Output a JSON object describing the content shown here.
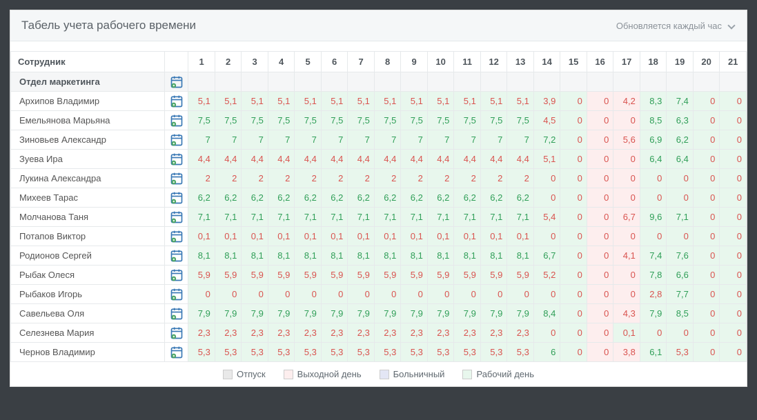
{
  "header": {
    "title": "Табель учета рабочего времени",
    "refresh": "Обновляется каждый час"
  },
  "columns": {
    "employee": "Сотрудник",
    "days": [
      "1",
      "2",
      "3",
      "4",
      "5",
      "6",
      "7",
      "8",
      "9",
      "10",
      "11",
      "12",
      "13",
      "14",
      "15",
      "16",
      "17",
      "18",
      "19",
      "20",
      "21"
    ]
  },
  "group": {
    "name": "Отдел маркетинга"
  },
  "weekend_days": [
    16,
    17
  ],
  "employees": [
    {
      "name": "Архипов Владимир",
      "vals": [
        "5,1",
        "5,1",
        "5,1",
        "5,1",
        "5,1",
        "5,1",
        "5,1",
        "5,1",
        "5,1",
        "5,1",
        "5,1",
        "5,1",
        "5,1",
        "3,9",
        "0",
        "0",
        "4,2",
        "8,3",
        "7,4",
        "0",
        "0"
      ],
      "is_red": true
    },
    {
      "name": "Емельянова Марьяна",
      "vals": [
        "7,5",
        "7,5",
        "7,5",
        "7,5",
        "7,5",
        "7,5",
        "7,5",
        "7,5",
        "7,5",
        "7,5",
        "7,5",
        "7,5",
        "7,5",
        "4,5",
        "0",
        "0",
        "0",
        "8,5",
        "6,3",
        "0",
        "0"
      ],
      "is_red": false
    },
    {
      "name": "Зиновьев Александр",
      "vals": [
        "7",
        "7",
        "7",
        "7",
        "7",
        "7",
        "7",
        "7",
        "7",
        "7",
        "7",
        "7",
        "7",
        "7,2",
        "0",
        "0",
        "5,6",
        "6,9",
        "6,2",
        "0",
        "0"
      ],
      "is_red": false
    },
    {
      "name": "Зуева Ира",
      "vals": [
        "4,4",
        "4,4",
        "4,4",
        "4,4",
        "4,4",
        "4,4",
        "4,4",
        "4,4",
        "4,4",
        "4,4",
        "4,4",
        "4,4",
        "4,4",
        "5,1",
        "0",
        "0",
        "0",
        "6,4",
        "6,4",
        "0",
        "0"
      ],
      "is_red": true
    },
    {
      "name": "Лукина Александра",
      "vals": [
        "2",
        "2",
        "2",
        "2",
        "2",
        "2",
        "2",
        "2",
        "2",
        "2",
        "2",
        "2",
        "2",
        "0",
        "0",
        "0",
        "0",
        "0",
        "0",
        "0",
        "0"
      ],
      "is_red": true
    },
    {
      "name": "Михеев Тарас",
      "vals": [
        "6,2",
        "6,2",
        "6,2",
        "6,2",
        "6,2",
        "6,2",
        "6,2",
        "6,2",
        "6,2",
        "6,2",
        "6,2",
        "6,2",
        "6,2",
        "0",
        "0",
        "0",
        "0",
        "0",
        "0",
        "0",
        "0"
      ],
      "is_red": false
    },
    {
      "name": "Молчанова Таня",
      "vals": [
        "7,1",
        "7,1",
        "7,1",
        "7,1",
        "7,1",
        "7,1",
        "7,1",
        "7,1",
        "7,1",
        "7,1",
        "7,1",
        "7,1",
        "7,1",
        "5,4",
        "0",
        "0",
        "6,7",
        "9,6",
        "7,1",
        "0",
        "0"
      ],
      "is_red": false
    },
    {
      "name": "Потапов Виктор",
      "vals": [
        "0,1",
        "0,1",
        "0,1",
        "0,1",
        "0,1",
        "0,1",
        "0,1",
        "0,1",
        "0,1",
        "0,1",
        "0,1",
        "0,1",
        "0,1",
        "0",
        "0",
        "0",
        "0",
        "0",
        "0",
        "0",
        "0"
      ],
      "is_red": true
    },
    {
      "name": "Родионов Сергей",
      "vals": [
        "8,1",
        "8,1",
        "8,1",
        "8,1",
        "8,1",
        "8,1",
        "8,1",
        "8,1",
        "8,1",
        "8,1",
        "8,1",
        "8,1",
        "8,1",
        "6,7",
        "0",
        "0",
        "4,1",
        "7,4",
        "7,6",
        "0",
        "0"
      ],
      "is_red": false
    },
    {
      "name": "Рыбак Олеся",
      "vals": [
        "5,9",
        "5,9",
        "5,9",
        "5,9",
        "5,9",
        "5,9",
        "5,9",
        "5,9",
        "5,9",
        "5,9",
        "5,9",
        "5,9",
        "5,9",
        "5,2",
        "0",
        "0",
        "0",
        "7,8",
        "6,6",
        "0",
        "0"
      ],
      "is_red": true
    },
    {
      "name": "Рыбаков Игорь",
      "vals": [
        "0",
        "0",
        "0",
        "0",
        "0",
        "0",
        "0",
        "0",
        "0",
        "0",
        "0",
        "0",
        "0",
        "0",
        "0",
        "0",
        "0",
        "2,8",
        "7,7",
        "0",
        "0"
      ],
      "is_red": true
    },
    {
      "name": "Савельева Оля",
      "vals": [
        "7,9",
        "7,9",
        "7,9",
        "7,9",
        "7,9",
        "7,9",
        "7,9",
        "7,9",
        "7,9",
        "7,9",
        "7,9",
        "7,9",
        "7,9",
        "8,4",
        "0",
        "0",
        "4,3",
        "7,9",
        "8,5",
        "0",
        "0"
      ],
      "is_red": false
    },
    {
      "name": "Селезнева Мария",
      "vals": [
        "2,3",
        "2,3",
        "2,3",
        "2,3",
        "2,3",
        "2,3",
        "2,3",
        "2,3",
        "2,3",
        "2,3",
        "2,3",
        "2,3",
        "2,3",
        "0",
        "0",
        "0",
        "0,1",
        "0",
        "0",
        "0",
        "0"
      ],
      "is_red": true
    },
    {
      "name": "Чернов Владимир",
      "vals": [
        "5,3",
        "5,3",
        "5,3",
        "5,3",
        "5,3",
        "5,3",
        "5,3",
        "5,3",
        "5,3",
        "5,3",
        "5,3",
        "5,3",
        "5,3",
        "6",
        "0",
        "0",
        "3,8",
        "6,1",
        "5,3",
        "0",
        "0"
      ],
      "is_red": true
    }
  ],
  "legend": {
    "vacation": "Отпуск",
    "weekend": "Выходной день",
    "sick": "Больничный",
    "workday": "Рабочий день"
  }
}
